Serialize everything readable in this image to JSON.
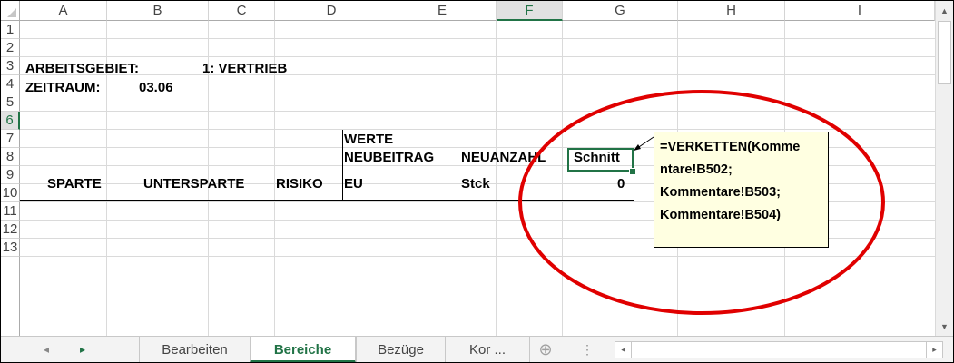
{
  "columns": [
    "A",
    "B",
    "C",
    "D",
    "E",
    "F",
    "G",
    "H",
    "I"
  ],
  "selected_column": "F",
  "rows": [
    "1",
    "2",
    "3",
    "4",
    "5",
    "6",
    "7",
    "8",
    "9",
    "10",
    "11",
    "12",
    "13"
  ],
  "selected_row": "6",
  "cells": {
    "A2": "ARBEITSGEBIET:",
    "B2": "1: VERTRIEB",
    "A3": "ZEITRAUM:",
    "B3": "03.06",
    "D5": "WERTE",
    "D6": "NEUBEITRAG",
    "E6": "NEUANZAHL",
    "F6": "Schnitt",
    "A7": "SPARTE",
    "B7": "UNTERSPARTE",
    "C7": "RISIKO",
    "D7": "EU",
    "E7": "Stck",
    "F7": "0"
  },
  "comment": {
    "lines": [
      "=VERKETTEN(Komme",
      "ntare!B502;",
      "Kommentare!B503;",
      "Kommentare!B504)"
    ]
  },
  "sheet_tabs": [
    {
      "label": "Bearbeiten",
      "active": false
    },
    {
      "label": "Bereiche",
      "active": true
    },
    {
      "label": "Bezüge",
      "active": false
    },
    {
      "label": "Kor ...",
      "active": false
    }
  ],
  "icons": {
    "prev_sheet": "◂",
    "next_sheet": "▸",
    "add_sheet": "⊕",
    "tab_split": "⋮",
    "scroll_up": "▲",
    "scroll_down": "▼",
    "scroll_left": "◂",
    "scroll_right": "▸"
  },
  "colors": {
    "accent": "#217346",
    "annotation": "#e00000",
    "comment_bg": "#ffffe1"
  }
}
